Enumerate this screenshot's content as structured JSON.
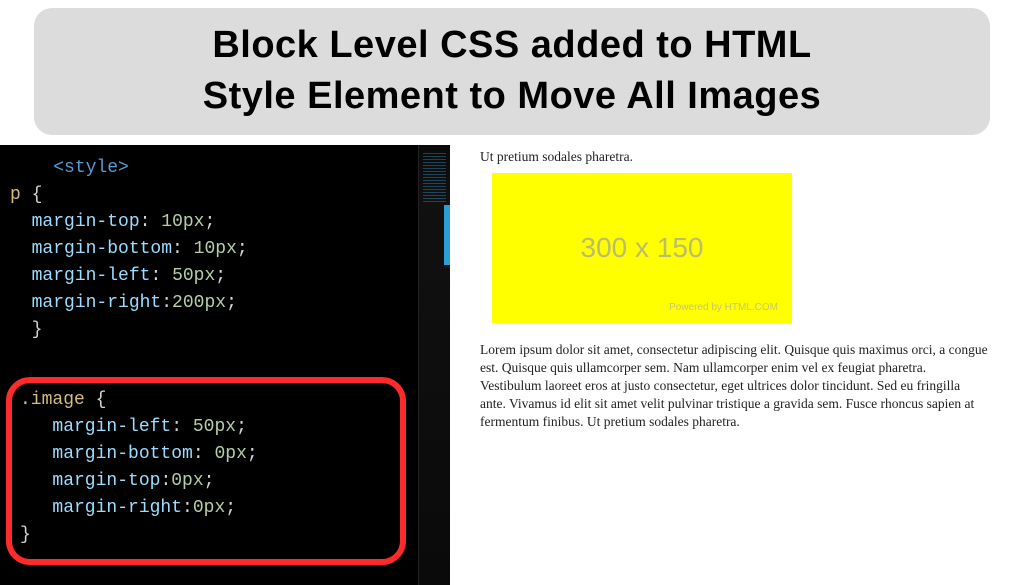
{
  "title": {
    "line1": "Block Level CSS added to HTML",
    "line2": "Style Element to Move All Images"
  },
  "code": {
    "styleOpen": "<style>",
    "pSelector": "p {",
    "pMarginTop": "  margin-top: 10px;",
    "pMarginBottom": "  margin-bottom: 10px;",
    "pMarginLeft": "  margin-left: 50px;",
    "pMarginRight": "  margin-right:200px;",
    "pClose": "  }",
    "imgSelector": ".image {",
    "imgMarginLeft": "   margin-left: 50px;",
    "imgMarginBottom": "   margin-bottom: 0px;",
    "imgMarginTop": "   margin-top:0px;",
    "imgMarginRight": "   margin-right:0px;",
    "imgClose": "}"
  },
  "preview": {
    "topText": "Ut pretium sodales pharetra.",
    "placeholderDims": "300 x 150",
    "placeholderCredit": "Powered by HTML.COM",
    "lorem": "Lorem ipsum dolor sit amet, consectetur adipiscing elit. Quisque quis maximus orci, a congue est. Quisque quis ullamcorper sem. Nam ullamcorper enim vel ex feugiat pharetra. Vestibulum laoreet eros at justo consectetur, eget ultrices dolor tincidunt. Sed eu fringilla ante. Vivamus id elit sit amet velit pulvinar tristique a gravida sem. Fusce rhoncus sapien at fermentum finibus. Ut pretium sodales pharetra."
  }
}
